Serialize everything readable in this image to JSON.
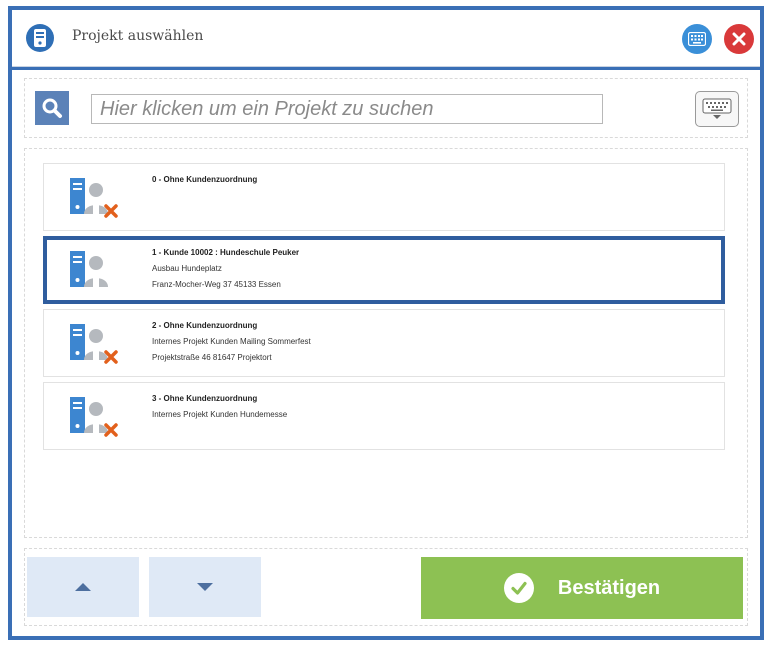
{
  "window": {
    "title": "Projekt auswählen"
  },
  "search": {
    "placeholder": "Hier klicken um ein Projekt zu suchen"
  },
  "projects": [
    {
      "title": "0 - Ohne Kundenzuordnung",
      "line1": "",
      "line2": "",
      "icon": "project-no-customer-icon",
      "selected": false
    },
    {
      "title": "1 - Kunde 10002 : Hundeschule Peuker",
      "line1": "Ausbau Hundeplatz",
      "line2": "Franz-Mocher-Weg 37 45133 Essen",
      "icon": "project-customer-icon",
      "selected": true
    },
    {
      "title": "2 - Ohne Kundenzuordnung",
      "line1": "Internes Projekt Kunden Mailing Sommerfest",
      "line2": "Projektstraße 46 81647 Projektort",
      "icon": "project-no-customer-icon",
      "selected": false
    },
    {
      "title": "3 - Ohne Kundenzuordnung",
      "line1": "Internes Projekt Kunden Hundemesse",
      "line2": "",
      "icon": "project-no-customer-icon",
      "selected": false
    }
  ],
  "buttons": {
    "confirm": "Bestätigen"
  },
  "colors": {
    "frame": "#3a6fb6",
    "selection": "#2f5d9e",
    "confirm": "#8dc153",
    "nav": "#dfe9f6",
    "close": "#d9393a"
  }
}
